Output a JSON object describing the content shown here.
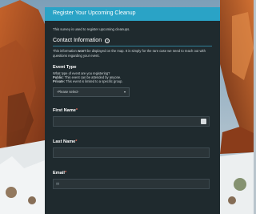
{
  "form": {
    "title": "Register Your Upcoming Cleanup",
    "intro": "This survey is used to register upcoming cleanups.",
    "contact_section": {
      "title": "Contact Information",
      "info_icon": "ⓘ",
      "note_prefix": "This information ",
      "note_emphasis": "won't",
      "note_suffix": " be displayed on the map. It is simply for the rare case we need to reach out with questions regarding your event."
    },
    "event_type": {
      "label": "Event Type",
      "hint": "What type of event are you registering?",
      "public_label": "Public:",
      "public_text": " This event can be attended by anyone.",
      "private_label": "Private:",
      "private_text": " This event is limited to a specific group.",
      "placeholder": "-Please select-"
    },
    "fields": [
      {
        "label": "First Name",
        "required": "*"
      },
      {
        "label": "Last Name",
        "required": "*"
      },
      {
        "label": "Email",
        "required": "*"
      }
    ]
  },
  "colors": {
    "header": "#2aa3c6",
    "panel": "#1f2a2e",
    "required": "#e46a5a"
  },
  "icons": {
    "info": "info-icon",
    "select": "chevron-down-icon",
    "autofill": "contact-card-icon",
    "email": "envelope-icon"
  }
}
